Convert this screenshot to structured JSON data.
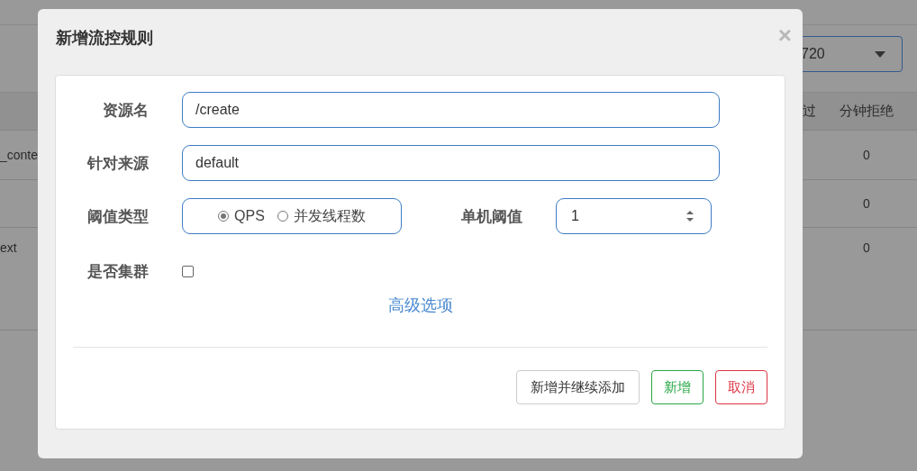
{
  "background": {
    "select": {
      "value": "720"
    },
    "table": {
      "columns": [
        "过",
        "分钟拒绝"
      ],
      "rows": [
        {
          "resource": "_conte",
          "rejected": "0"
        },
        {
          "rejected": "0"
        },
        {
          "resource": "ext",
          "rejected": "0"
        }
      ]
    }
  },
  "dialog": {
    "title": "新增流控规则",
    "close": "×",
    "fields": [
      {
        "kind": "text",
        "label": "资源名",
        "value": "/create"
      },
      {
        "kind": "text",
        "label": "针对来源",
        "value": "default"
      },
      {
        "kind": "threshold",
        "label": "阈值类型",
        "options": [
          {
            "label": "QPS",
            "selected": true
          },
          {
            "label": "并发线程数",
            "selected": false
          }
        ],
        "extra": {
          "label": "单机阈值",
          "value": "1"
        }
      },
      {
        "kind": "checkbox",
        "label": "是否集群",
        "checked": false
      }
    ],
    "advanced_link": "高级选项",
    "buttons": [
      {
        "label": "新增并继续添加",
        "kind": "default"
      },
      {
        "label": "新增",
        "kind": "success"
      },
      {
        "label": "取消",
        "kind": "danger"
      }
    ]
  }
}
